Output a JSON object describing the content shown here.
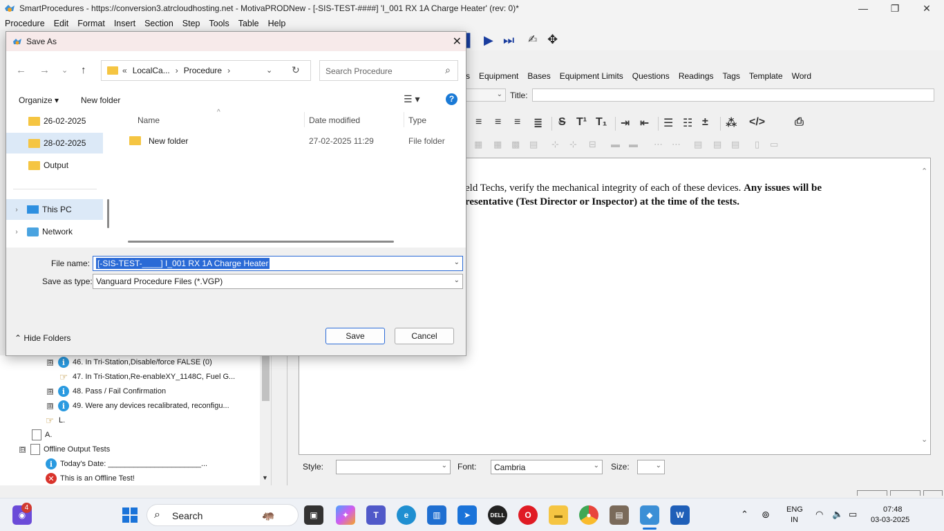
{
  "app": {
    "title": "SmartProcedures - https://conversion3.atrcloudhosting.net - MotivaPRODNew - [-SIS-TEST-####] 'I_001 RX 1A Charge Heater' (rev: 0)*",
    "min": "—",
    "max": "❐",
    "close": "✕"
  },
  "menu": [
    "Procedure",
    "Edit",
    "Format",
    "Insert",
    "Section",
    "Step",
    "Tools",
    "Table",
    "Help"
  ],
  "tabs": [
    "s",
    "Equipment",
    "Bases",
    "Equipment Limits",
    "Questions",
    "Readings",
    "Tags",
    "Template",
    "Word"
  ],
  "title_label": "Title:",
  "editor": {
    "line1_normal": "eld Techs, verify the mechanical integrity of each of these devices. ",
    "line1_bold": "Any issues will be",
    "line2_bold": "resentative (Test Director or Inspector) at the time of the tests."
  },
  "style_row": {
    "style_label": "Style:",
    "font_label": "Font:",
    "font_value": "Cambria",
    "size_label": "Size:"
  },
  "tree": [
    {
      "label": "46. In Tri-Station,Disable/force FALSE (0)",
      "icon": "info-icon",
      "expander": "⊞"
    },
    {
      "label": "47. In Tri-Station,Re-enableXY_1148C, Fuel G...",
      "icon": "hand-icon",
      "expander": ""
    },
    {
      "label": "48. Pass / Fail Confirmation",
      "icon": "info-icon",
      "expander": "⊞"
    },
    {
      "label": "49. Were any devices recalibrated, reconfigu...",
      "icon": "info-icon",
      "expander": "⊞"
    },
    {
      "label": "L.",
      "icon": "hand-icon",
      "expander": ""
    },
    {
      "label": "A.",
      "icon": "doc-icon",
      "expander": ""
    },
    {
      "label": "Offline Output Tests",
      "icon": "doc-icon",
      "expander": "⊟"
    },
    {
      "label": "Today's Date: ______________________...",
      "icon": "info-icon",
      "expander": ""
    },
    {
      "label": "This is an Offline Test!",
      "icon": "error-icon",
      "expander": ""
    }
  ],
  "dialog": {
    "title": "Save As",
    "address": {
      "crumb1": "LocalCa...",
      "crumb2": "Procedure"
    },
    "search_placeholder": "Search Procedure",
    "organize": "Organize ▾",
    "new_folder": "New folder",
    "nav_items": [
      "26-02-2025",
      "28-02-2025",
      "Output",
      "This PC",
      "Network"
    ],
    "columns": {
      "name": "Name",
      "date": "Date modified",
      "type": "Type"
    },
    "files": [
      {
        "name": "New folder",
        "date": "27-02-2025 11:29",
        "type": "File folder"
      }
    ],
    "file_name_label": "File name:",
    "file_name_selected": "[-SIS-TEST-____] I_001 RX 1A Charge Heater",
    "save_type_label": "Save as type:",
    "save_type_value": "Vanguard Procedure Files (*.VGP)",
    "hide_folders": "Hide Folders",
    "save": "Save",
    "cancel": "Cancel"
  },
  "taskbar": {
    "search": "Search",
    "badge": "4",
    "lang": "ENG",
    "region": "IN",
    "time": "07:48",
    "date": "03-03-2025"
  },
  "colors": {
    "accent": "#2a6ad6",
    "folder": "#f5c542",
    "title_bg": "#f7eaea"
  }
}
